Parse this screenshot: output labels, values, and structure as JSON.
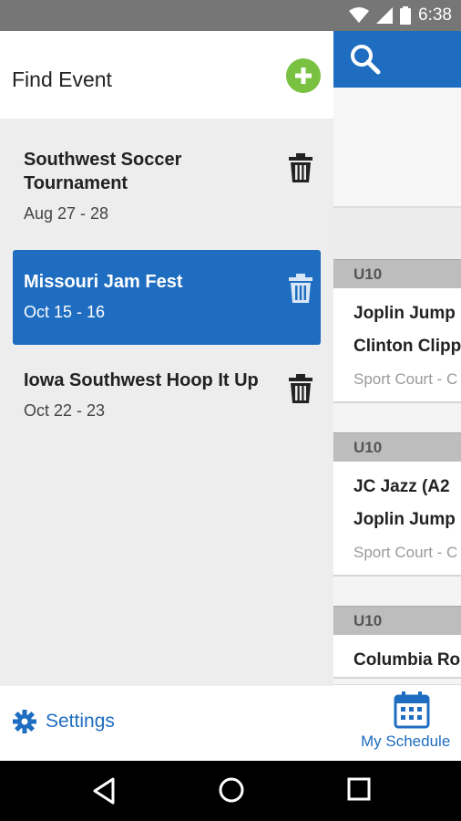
{
  "status": {
    "time": "6:38",
    "icons": [
      "wifi-icon",
      "signal-icon",
      "battery-icon"
    ]
  },
  "drawer": {
    "title": "Find Event",
    "events": [
      {
        "name": "Southwest Soccer Tournament",
        "date": "Aug 27 - 28",
        "selected": false
      },
      {
        "name": "Missouri Jam Fest",
        "date": "Oct 15 - 16",
        "selected": true
      },
      {
        "name": "Iowa Southwest Hoop It Up",
        "date": "Oct 22 - 23",
        "selected": false
      }
    ],
    "settings_label": "Settings"
  },
  "background": {
    "groups": [
      {
        "division": "U10",
        "line1": "Joplin Jump",
        "line2": "Clinton Clipp",
        "venue": "Sport Court - C"
      },
      {
        "division": "U10",
        "line1": "JC Jazz (A2",
        "line2": "Joplin Jump",
        "venue": "Sport Court - C"
      },
      {
        "division": "U10",
        "line1": "Columbia Ro"
      }
    ],
    "bottom_tab_label": "My Schedule"
  },
  "colors": {
    "accent": "#1f6dc0",
    "add": "#79c141",
    "status_bar": "#767676"
  }
}
